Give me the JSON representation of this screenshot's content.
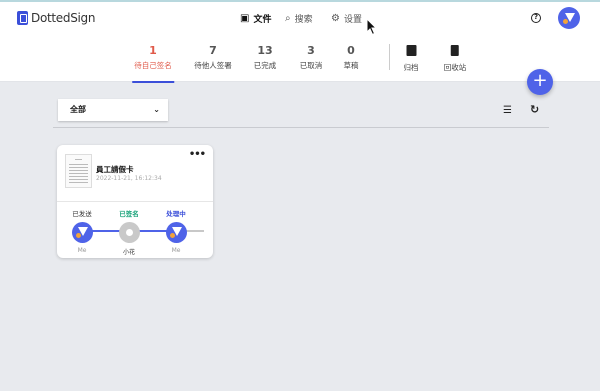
{
  "app": {
    "logo_text": "DottedSign",
    "brand_color": "#3b4fd9",
    "accent_color": "#e05a4a"
  },
  "topnav": {
    "docs": {
      "label": "文件",
      "icon": "inbox-icon"
    },
    "search": {
      "label": "搜索",
      "icon": "search-icon"
    },
    "settings": {
      "label": "设置",
      "icon": "gear-icon"
    },
    "help_icon": "question-icon"
  },
  "status_tabs": [
    {
      "count": "1",
      "label": "待自己签名"
    },
    {
      "count": "7",
      "label": "待他人签署"
    },
    {
      "count": "13",
      "label": "已完成"
    },
    {
      "count": "3",
      "label": "已取消"
    },
    {
      "count": "0",
      "label": "草稿"
    }
  ],
  "archive_tabs": [
    {
      "label": "归档",
      "icon": "archive-icon"
    },
    {
      "label": "回收站",
      "icon": "trash-icon"
    }
  ],
  "fab": {
    "label": "+"
  },
  "filter": {
    "selected": "全部"
  },
  "view_icons": {
    "list": "list-view-icon",
    "refresh": "refresh-icon"
  },
  "documents": [
    {
      "title": "員工請假卡",
      "date": "2022-11-21, 16:12:34",
      "steps": [
        {
          "status": "已发送",
          "name": "Me",
          "color": "#333333"
        },
        {
          "status": "已签名",
          "name": "小花",
          "color": "#1aa37a"
        },
        {
          "status": "处理中",
          "name": "Me",
          "color": "#3b4fd9"
        }
      ]
    }
  ]
}
